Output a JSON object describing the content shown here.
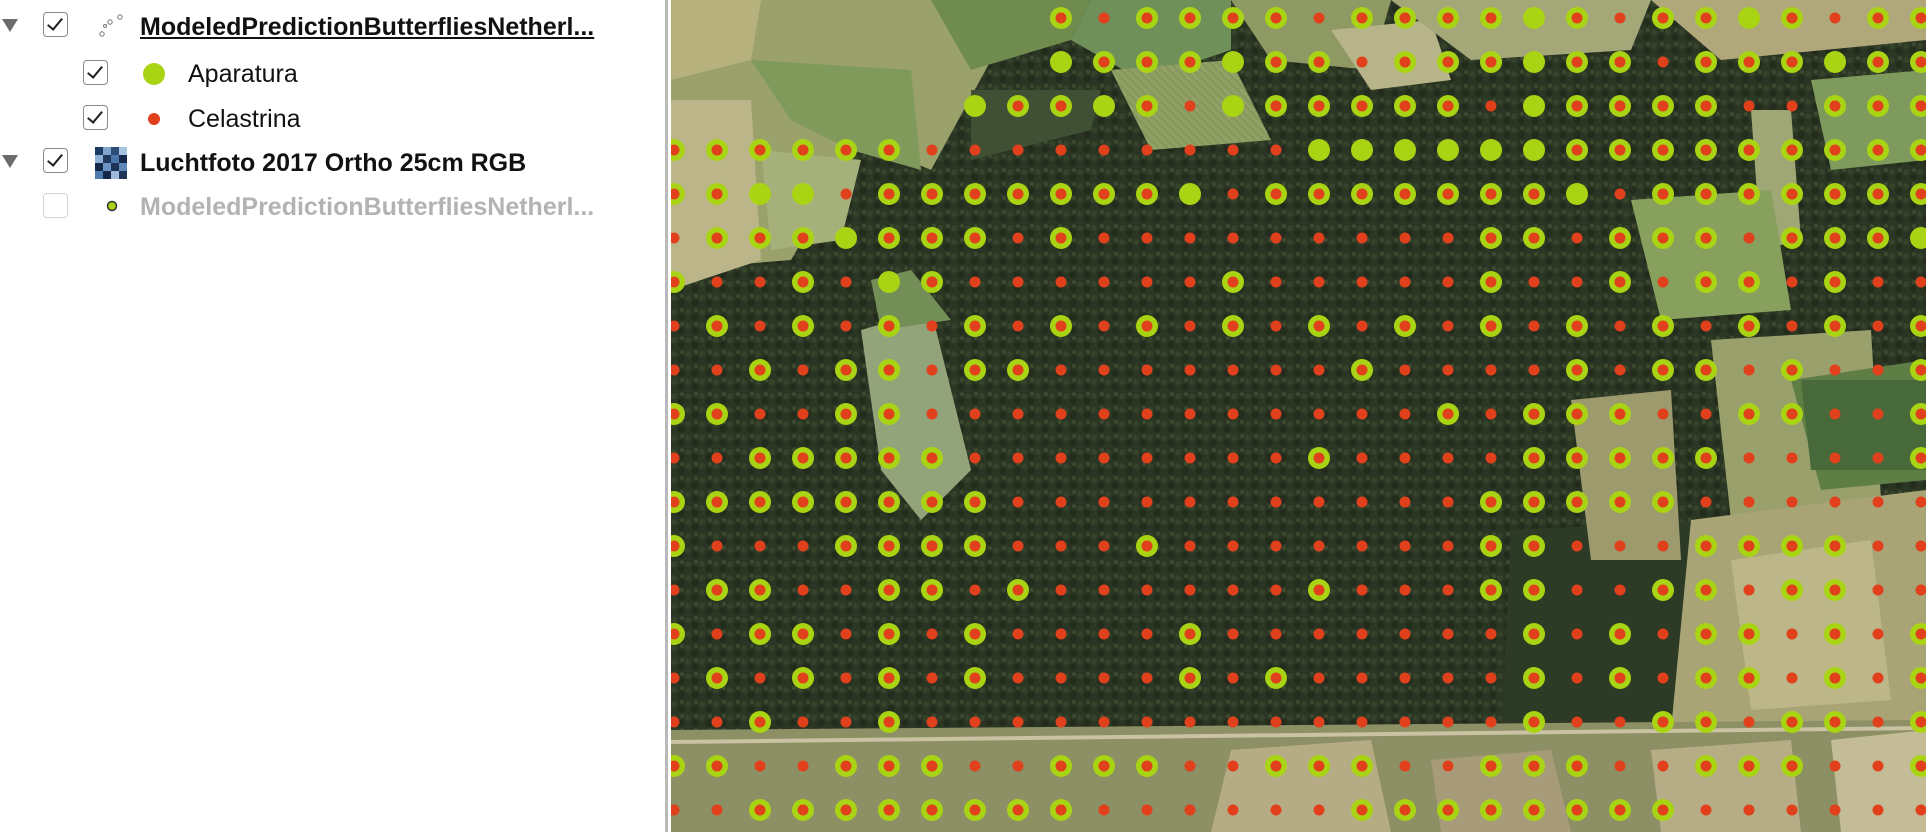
{
  "layers_panel": {
    "layers": [
      {
        "name": "ModeledPredictionButterfliesNetherl...",
        "checked": true,
        "expanded": true,
        "style": "bold-underline",
        "icon": "point-layer-icon"
      },
      {
        "name": "Aparatura",
        "checked": true,
        "icon": "green-dot-icon",
        "color": "#a8d414"
      },
      {
        "name": "Celastrina",
        "checked": true,
        "icon": "red-dot-icon",
        "color": "#e0401c"
      },
      {
        "name": "Luchtfoto 2017 Ortho 25cm RGB",
        "checked": true,
        "expanded": true,
        "style": "bold",
        "icon": "raster-layer-icon"
      },
      {
        "name": "ModeledPredictionButterfliesNetherl...",
        "checked": false,
        "style": "disabled",
        "icon": "point-layer-small-icon"
      }
    ]
  },
  "map": {
    "basemap": "aerial photo",
    "symbols": {
      "aparatura_color": "#a8d414",
      "celastrina_color": "#e0401c"
    }
  }
}
